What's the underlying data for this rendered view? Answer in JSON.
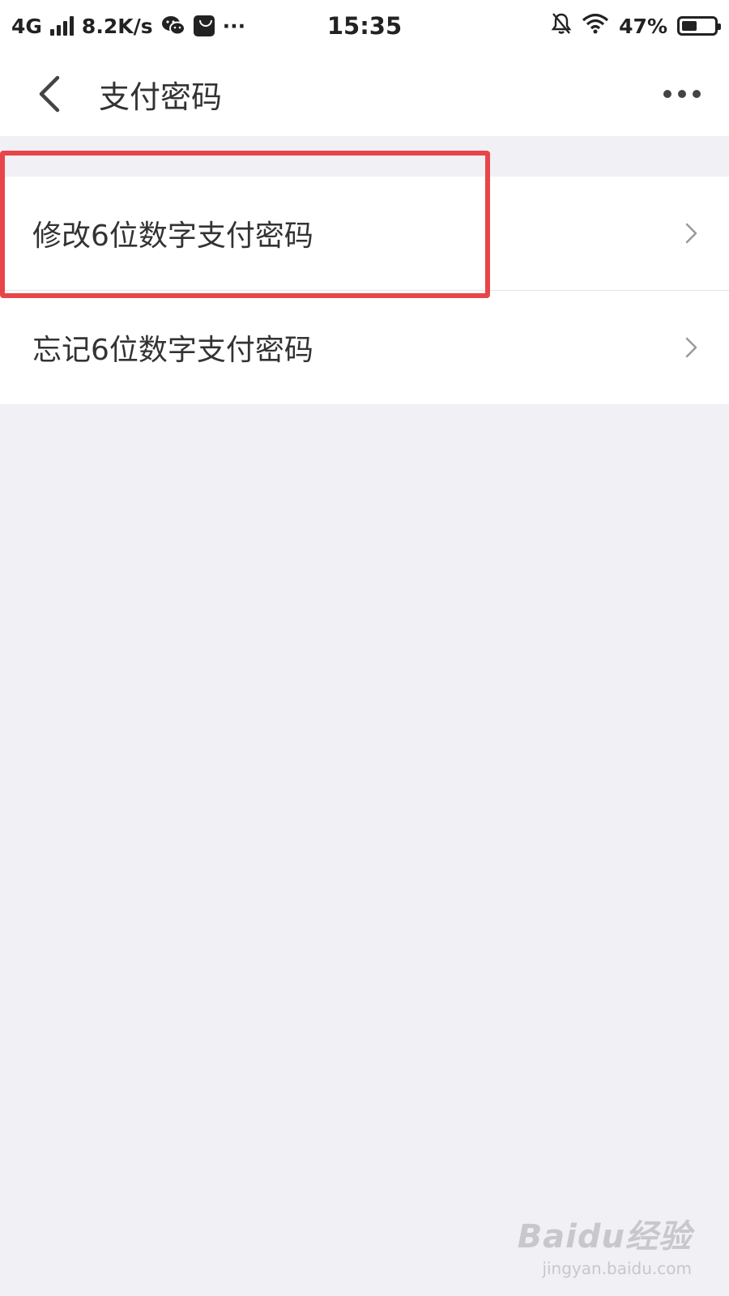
{
  "status_bar": {
    "network": "4G",
    "speed": "8.2K/s",
    "more": "···",
    "time": "15:35",
    "battery": "47%",
    "battery_level": 0.47
  },
  "nav": {
    "title": "支付密码"
  },
  "list": {
    "items": [
      {
        "label": "修改6位数字支付密码"
      },
      {
        "label": "忘记6位数字支付密码"
      }
    ]
  },
  "watermark": {
    "logo": "Baidu经验",
    "sub": "jingyan.baidu.com"
  },
  "colors": {
    "background": "#f0f0f5",
    "highlight": "#e8454a"
  }
}
